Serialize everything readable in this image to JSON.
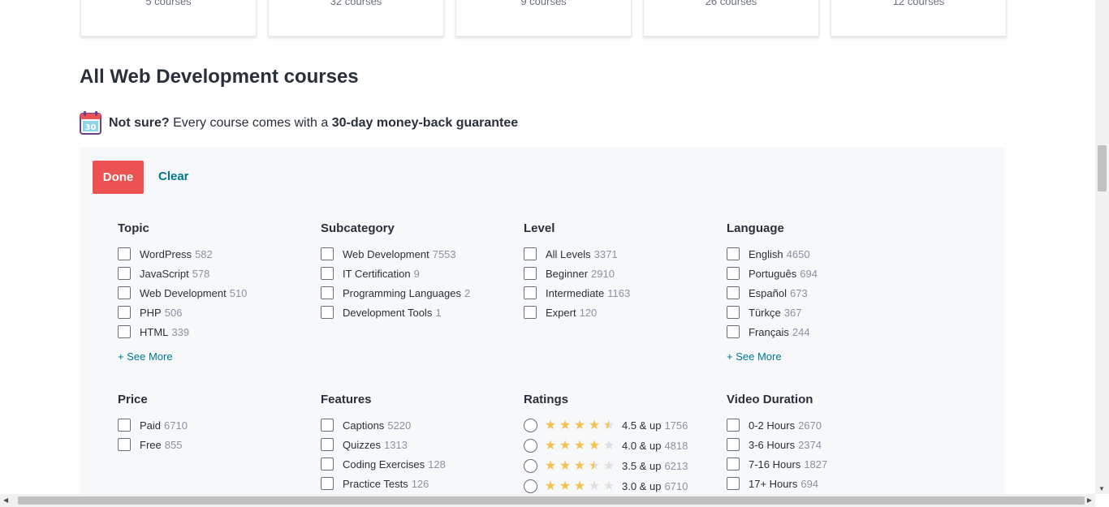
{
  "top_cards": [
    {
      "label": "5 courses"
    },
    {
      "label": "32 courses"
    },
    {
      "label": "9 courses"
    },
    {
      "label": "26 courses"
    },
    {
      "label": "12 courses"
    }
  ],
  "title": "All Web Development courses",
  "guarantee": {
    "icon": "calendar-icon",
    "icon_text": "30",
    "lead": "Not sure?",
    "middle": " Every course comes with a ",
    "highlight": "30-day money-back guarantee"
  },
  "filters": {
    "done_label": "Done",
    "clear_label": "Clear",
    "colors": {
      "done": "#ec5252",
      "link": "#007791",
      "star": "#f4c150"
    },
    "topic": {
      "title": "Topic",
      "options": [
        {
          "label": "WordPress",
          "count": "582"
        },
        {
          "label": "JavaScript",
          "count": "578"
        },
        {
          "label": "Web Development",
          "count": "510"
        },
        {
          "label": "PHP",
          "count": "506"
        },
        {
          "label": "HTML",
          "count": "339"
        }
      ],
      "see_more": "+ See More"
    },
    "subcategory": {
      "title": "Subcategory",
      "options": [
        {
          "label": "Web Development",
          "count": "7553"
        },
        {
          "label": "IT Certification",
          "count": "9"
        },
        {
          "label": "Programming Languages",
          "count": "2"
        },
        {
          "label": "Development Tools",
          "count": "1"
        }
      ]
    },
    "level": {
      "title": "Level",
      "options": [
        {
          "label": "All Levels",
          "count": "3371"
        },
        {
          "label": "Beginner",
          "count": "2910"
        },
        {
          "label": "Intermediate",
          "count": "1163"
        },
        {
          "label": "Expert",
          "count": "120"
        }
      ]
    },
    "language": {
      "title": "Language",
      "options": [
        {
          "label": "English",
          "count": "4650"
        },
        {
          "label": "Português",
          "count": "694"
        },
        {
          "label": "Español",
          "count": "673"
        },
        {
          "label": "Türkçe",
          "count": "367"
        },
        {
          "label": "Français",
          "count": "244"
        }
      ],
      "see_more": "+ See More"
    },
    "price": {
      "title": "Price",
      "options": [
        {
          "label": "Paid",
          "count": "6710"
        },
        {
          "label": "Free",
          "count": "855"
        }
      ]
    },
    "features": {
      "title": "Features",
      "options": [
        {
          "label": "Captions",
          "count": "5220"
        },
        {
          "label": "Quizzes",
          "count": "1313"
        },
        {
          "label": "Coding Exercises",
          "count": "128"
        },
        {
          "label": "Practice Tests",
          "count": "126"
        }
      ]
    },
    "ratings": {
      "title": "Ratings",
      "options": [
        {
          "stars": 4.5,
          "label": "4.5 & up",
          "count": "1756"
        },
        {
          "stars": 4.0,
          "label": "4.0 & up",
          "count": "4818"
        },
        {
          "stars": 3.5,
          "label": "3.5 & up",
          "count": "6213"
        },
        {
          "stars": 3.0,
          "label": "3.0 & up",
          "count": "6710"
        }
      ]
    },
    "video_duration": {
      "title": "Video Duration",
      "options": [
        {
          "label": "0-2 Hours",
          "count": "2670"
        },
        {
          "label": "3-6 Hours",
          "count": "2374"
        },
        {
          "label": "7-16 Hours",
          "count": "1827"
        },
        {
          "label": "17+ Hours",
          "count": "694"
        }
      ]
    }
  }
}
